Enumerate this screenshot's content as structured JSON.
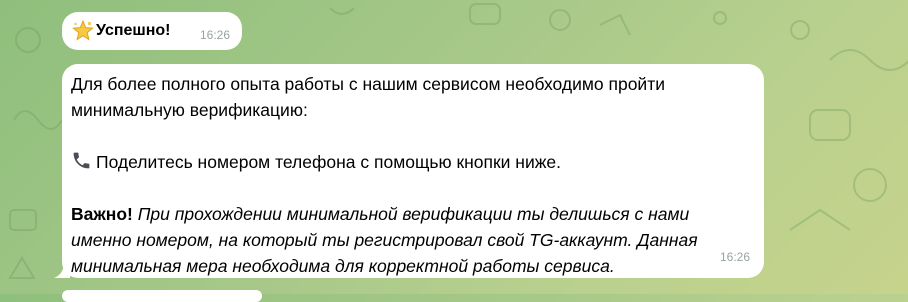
{
  "colors": {
    "bubble_bg": "#ffffff",
    "time_text": "#9aa3a0",
    "wallpaper_start": "#8fbf7c",
    "wallpaper_end": "#c6d38b"
  },
  "messages": [
    {
      "icon": "star-icon",
      "title": "Успешно!",
      "time": "16:26"
    },
    {
      "paragraph_1": "Для более полного опыта работы с нашим сервисом необходимо пройти минимальную верификацию:",
      "phone_icon": "phone-icon",
      "paragraph_2": "Поделитесь номером телефона с помощью кнопки ниже.",
      "important_label": "Важно!",
      "important_text": "При прохождении минимальной верификации ты делишься с нами именно номером, на который ты регистрировал свой TG-аккаунт. Данная минимальная мера необходима для корректной работы сервиса.",
      "time": "16:26"
    }
  ]
}
